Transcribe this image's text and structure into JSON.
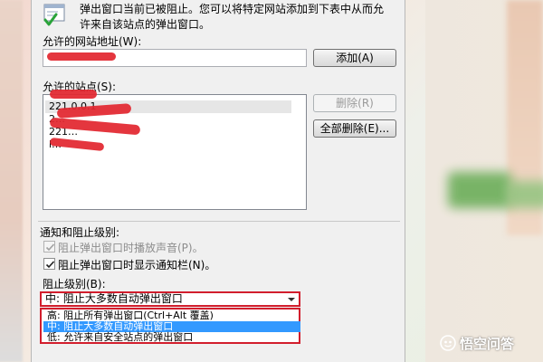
{
  "dialog": {
    "info_line1": "弹出窗口当前已被阻止。您可以将特定网站添加到下表中从而允",
    "info_line2": "许来自该站点的弹出窗口。",
    "allow_url_label": "允许的网站地址(W):",
    "allow_url_value": "",
    "add_button": "添加(A)",
    "allowed_sites_label": "允许的站点(S):",
    "allowed_sites": [
      "221.0.0.1",
      "2…",
      "221…",
      "l…"
    ],
    "remove_button": "删除(R)",
    "remove_all_button": "全部删除(E)...",
    "notify_section_title": "通知和阻止级别:",
    "play_sound_label": "阻止弹出窗口时播放声音(P)。",
    "play_sound_checked": true,
    "play_sound_disabled": true,
    "show_bar_label": "阻止弹出窗口时显示通知栏(N)。",
    "show_bar_checked": true,
    "block_level_label": "阻止级别(B):",
    "block_level_value": "中: 阻止大多数自动弹出窗口",
    "block_level_options": [
      "高: 阻止所有弹出窗口(Ctrl+Alt 覆盖)",
      "中: 阻止大多数自动弹出窗口",
      "低: 允许来自安全站点的弹出窗口"
    ],
    "highlighted_option_index": 1
  },
  "watermark": {
    "text": "悟空问答"
  },
  "colors": {
    "dialog_bg": "#f0f0f0",
    "redaction": "#e2272f",
    "highlight": "#3399ff",
    "icon_green": "#2aa33a"
  },
  "icons": {
    "info": "popup-blocked-icon",
    "checkmark": "checkmark-icon",
    "dropdown_arrow": "chevron-down-icon",
    "watermark_logo": "wukong-logo-icon"
  }
}
